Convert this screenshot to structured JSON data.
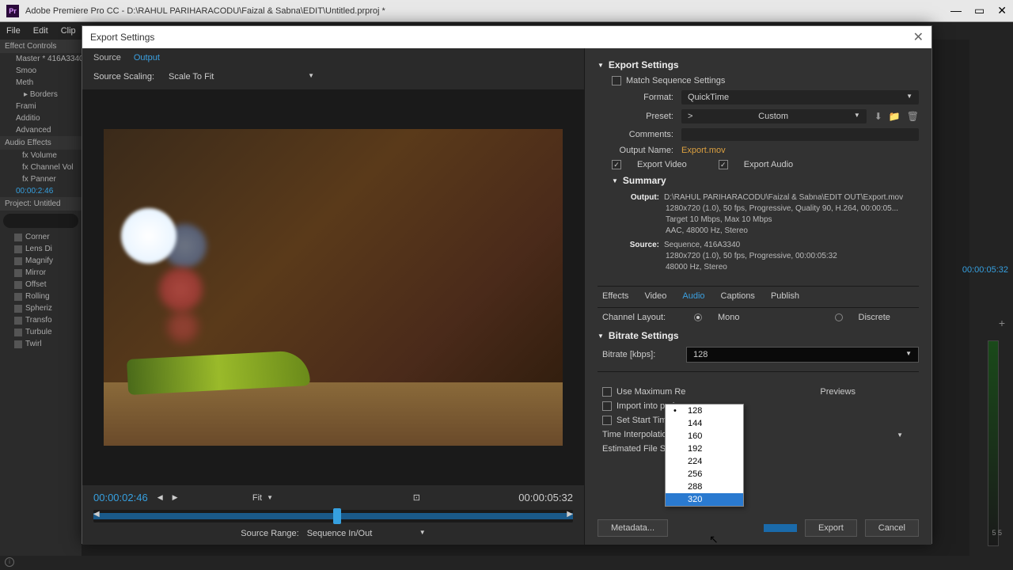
{
  "app": {
    "title": "Adobe Premiere Pro CC - D:\\RAHUL PARIHARACODU\\Faizal & Sabna\\EDIT\\Untitled.prproj *",
    "menu": [
      "File",
      "Edit",
      "Clip"
    ]
  },
  "left_panel": {
    "effect_controls": "Effect Controls",
    "master": "Master * 416A3340",
    "items": [
      "Smoo",
      "Meth",
      "Borders",
      "Frami",
      "Additio",
      "Advanced"
    ],
    "audio_effects": "Audio Effects",
    "fx": [
      "Volume",
      "Channel Vol",
      "Panner"
    ],
    "tc": "00:00:2:46",
    "project": "Project: Untitled",
    "effects": [
      "Corner",
      "Lens Di",
      "Magnify",
      "Mirror",
      "Offset",
      "Rolling",
      "Spheriz",
      "Transfo",
      "Turbule",
      "Twirl"
    ]
  },
  "right_edge": {
    "tc": "00:00:05:32",
    "small_tc": "5 5"
  },
  "dialog": {
    "title": "Export Settings",
    "tabs": {
      "source": "Source",
      "output": "Output"
    },
    "scaling_label": "Source Scaling:",
    "scaling_value": "Scale To Fit",
    "tc_in": "00:00:02:46",
    "tc_out": "00:00:05:32",
    "fit": "Fit",
    "range_label": "Source Range:",
    "range_value": "Sequence In/Out"
  },
  "export": {
    "header": "Export Settings",
    "match": "Match Sequence Settings",
    "format_label": "Format:",
    "format_value": "QuickTime",
    "preset_label": "Preset:",
    "preset_value": "Custom",
    "comments_label": "Comments:",
    "outname_label": "Output Name:",
    "outname_value": "Export.mov",
    "export_video": "Export Video",
    "export_audio": "Export Audio",
    "summary_header": "Summary",
    "output_label": "Output:",
    "output_lines": [
      "D:\\RAHUL PARIHARACODU\\Faizal & Sabna\\EDIT OUT\\Export.mov",
      "1280x720 (1.0), 50 fps, Progressive, Quality 90, H.264, 00:00:05...",
      "Target 10 Mbps, Max 10 Mbps",
      "AAC, 48000 Hz, Stereo"
    ],
    "source_label": "Source:",
    "source_lines": [
      "Sequence, 416A3340",
      "1280x720 (1.0), 50 fps, Progressive, 00:00:05:32",
      "48000 Hz, Stereo"
    ],
    "subtabs": [
      "Effects",
      "Video",
      "Audio",
      "Captions",
      "Publish"
    ],
    "subtab_active": "Audio",
    "channel_label": "Channel Layout:",
    "channel_opts": [
      "Mono",
      "Discrete"
    ],
    "bitrate_header": "Bitrate Settings",
    "bitrate_label": "Bitrate [kbps]:",
    "bitrate_value": "128",
    "bitrate_options": [
      "128",
      "144",
      "160",
      "192",
      "224",
      "256",
      "288",
      "320"
    ],
    "opts": {
      "max_render": "Use Maximum Re",
      "previews": "Previews",
      "import": "Import into proje",
      "start_tc": "Set Start Timeco"
    },
    "interp_label": "Time Interpolation:",
    "filesize_label": "Estimated File Size:",
    "metadata_btn": "Metadata...",
    "export_btn": "Export",
    "cancel_btn": "Cancel"
  }
}
